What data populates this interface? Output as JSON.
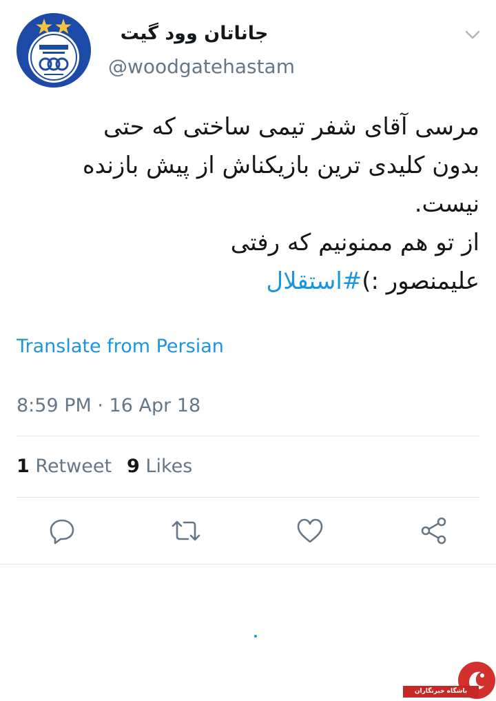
{
  "user": {
    "display_name": "جاناتان وود گیت",
    "handle": "@woodgatehastam"
  },
  "tweet": {
    "lines": [
      "مرسی آقای شفر تیمی ساختی که حتی",
      "بدون کلیدی ترین بازیکناش از پیش بازنده",
      "نیست.",
      "از تو هم ممنونیم که رفتی"
    ],
    "last_line_text": "علیمنصور :)",
    "hashtag": "#استقلال"
  },
  "translate_label": "Translate from Persian",
  "timestamp": "8:59 PM · 16 Apr 18",
  "stats": {
    "retweets_count": "1",
    "retweets_label": "Retweet",
    "likes_count": "9",
    "likes_label": "Likes"
  },
  "actions": [
    "reply-icon",
    "retweet-icon",
    "like-icon",
    "share-icon"
  ],
  "watermark": {
    "label": "باشگاه خبرنگاران"
  },
  "colors": {
    "accent": "#1b95e0",
    "secondary_text": "#657786",
    "divider": "#e1e8ed",
    "avatar_blue": "#1d4aa6",
    "watermark_red": "#c62828"
  }
}
